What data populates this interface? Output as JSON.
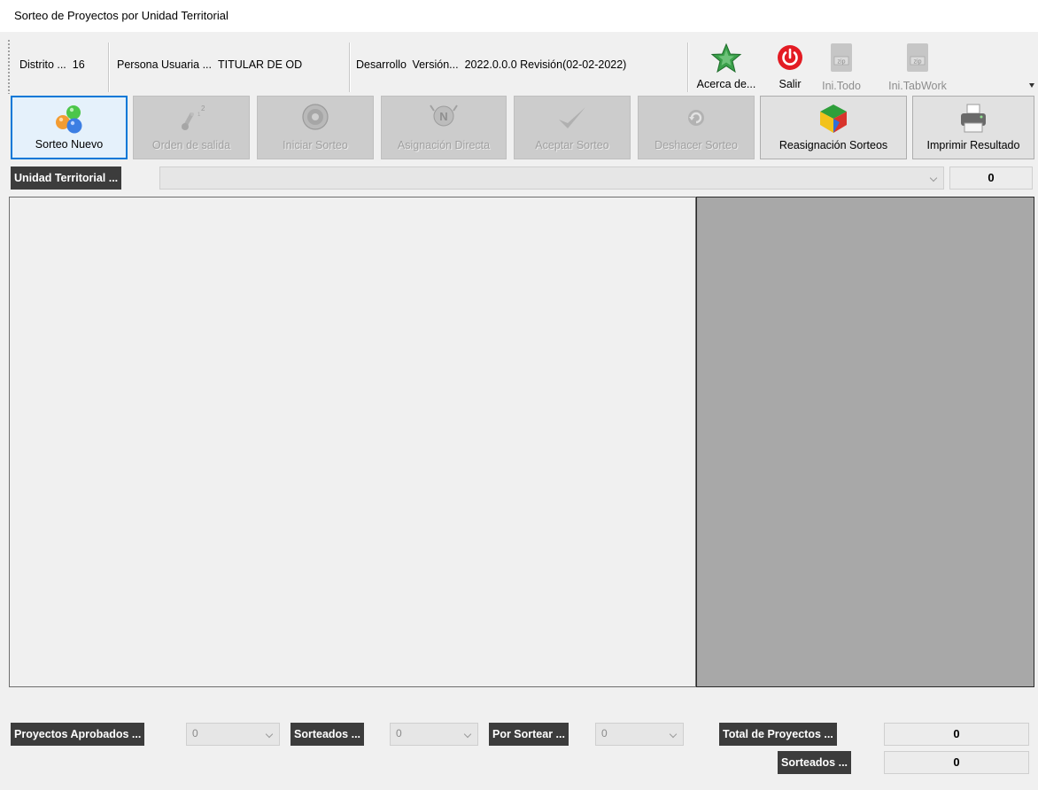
{
  "window": {
    "title": "Sorteo de Proyectos por Unidad Territorial"
  },
  "status": {
    "distrito_label": "Distrito ...",
    "distrito_value": "16",
    "persona_label": "Persona Usuaria ...",
    "persona_value": "TITULAR DE OD",
    "entorno": "Desarrollo",
    "version_label": "Versión...",
    "version_value": "2022.0.0.0 Revisión(02-02-2022)"
  },
  "tools": {
    "acerca": "Acerca de...",
    "salir": "Salir",
    "ini_todo": "Ini.Todo",
    "ini_tabwork": "Ini.TabWork"
  },
  "buttons": {
    "sorteo_nuevo": "Sorteo Nuevo",
    "orden_salida": "Orden de salida",
    "iniciar_sorteo": "Iniciar Sorteo",
    "asignacion_directa": "Asignación Directa",
    "aceptar_sorteo": "Aceptar Sorteo",
    "deshacer_sorteo": "Deshacer Sorteo",
    "reasignacion_sorteos": "Reasignación Sorteos",
    "imprimir_resultado": "Imprimir Resultado"
  },
  "unidad": {
    "label": "Unidad Territorial ...",
    "selected": "",
    "count": "0"
  },
  "footer": {
    "aprobados_label": "Proyectos Aprobados ...",
    "aprobados_value": "0",
    "sorteados_label": "Sorteados ...",
    "sorteados_value": "0",
    "por_sortear_label": "Por Sortear ...",
    "por_sortear_value": "0",
    "total_label": "Total de Proyectos ...",
    "total_value": "0",
    "total_sorteados_label": "Sorteados ...",
    "total_sorteados_value": "0"
  },
  "colors": {
    "accent": "#0078d7",
    "dark_label": "#3c3c3c",
    "panel_right": "#a8a8a8",
    "exit_red": "#e31b23"
  },
  "icons": {
    "acerca": "star-icon",
    "salir": "power-icon",
    "ini_todo": "zip-icon",
    "ini_tabwork": "zip-icon",
    "sorteo_nuevo": "balls-icon",
    "orden_salida": "order-icon",
    "iniciar_sorteo": "disc-icon",
    "asignacion_directa": "assign-icon",
    "aceptar_sorteo": "check-icon",
    "deshacer_sorteo": "undo-icon",
    "reasignacion_sorteos": "colorful-cube-icon",
    "imprimir_resultado": "printer-icon"
  }
}
